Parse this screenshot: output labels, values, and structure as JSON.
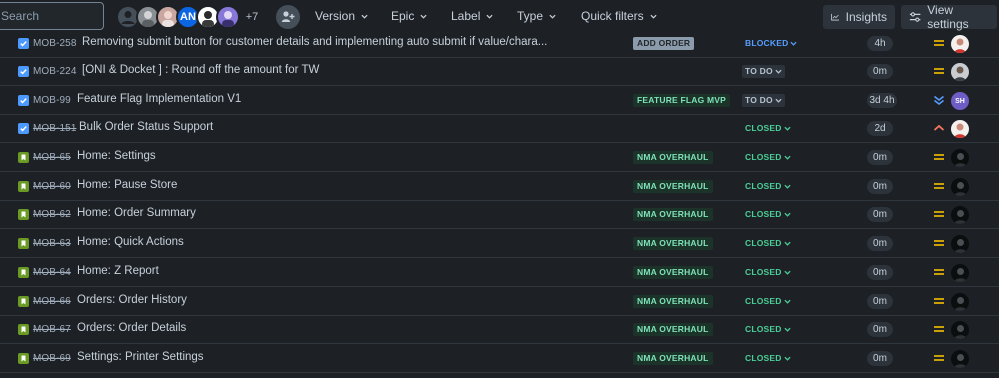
{
  "toolbar": {
    "search_placeholder": "Search",
    "avatar_initials": "AN",
    "more_count": "+7",
    "filters": [
      "Version",
      "Epic",
      "Label",
      "Type",
      "Quick filters"
    ],
    "insights_label": "Insights",
    "view_settings_label": "View settings"
  },
  "rows": [
    {
      "type": "task",
      "key": "MOB-258",
      "done": false,
      "summary": "Removing submit button for customer details and implementing auto submit if value/chara...",
      "label": "ADD ORDER",
      "status": "BLOCKED",
      "estimate": "4h",
      "priority": "medium"
    },
    {
      "type": "task",
      "key": "MOB-224",
      "done": false,
      "summary": "[ONI & Docket ] : Round off the amount for TW",
      "label": "",
      "status": "TO DO",
      "estimate": "0m",
      "priority": "medium"
    },
    {
      "type": "task",
      "key": "MOB-99",
      "done": false,
      "summary": "Feature Flag Implementation V1",
      "label": "FEATURE FLAG MVP",
      "status": "TO DO",
      "estimate": "3d 4h",
      "priority": "lowest",
      "assignee_initials": "SH"
    },
    {
      "type": "task",
      "key": "MOB-151",
      "done": true,
      "summary": "Bulk Order Status Support",
      "label": "",
      "status": "CLOSED",
      "estimate": "2d",
      "priority": "high"
    },
    {
      "type": "story",
      "key": "MOB-65",
      "done": true,
      "summary": "Home: Settings",
      "label": "NMA OVERHAUL",
      "status": "CLOSED",
      "estimate": "0m",
      "priority": "medium"
    },
    {
      "type": "story",
      "key": "MOB-60",
      "done": true,
      "summary": "Home: Pause Store",
      "label": "NMA OVERHAUL",
      "status": "CLOSED",
      "estimate": "0m",
      "priority": "medium"
    },
    {
      "type": "story",
      "key": "MOB-62",
      "done": true,
      "summary": "Home: Order Summary",
      "label": "NMA OVERHAUL",
      "status": "CLOSED",
      "estimate": "0m",
      "priority": "medium"
    },
    {
      "type": "story",
      "key": "MOB-63",
      "done": true,
      "summary": "Home: Quick Actions",
      "label": "NMA OVERHAUL",
      "status": "CLOSED",
      "estimate": "0m",
      "priority": "medium"
    },
    {
      "type": "story",
      "key": "MOB-64",
      "done": true,
      "summary": "Home: Z Report",
      "label": "NMA OVERHAUL",
      "status": "CLOSED",
      "estimate": "0m",
      "priority": "medium"
    },
    {
      "type": "story",
      "key": "MOB-66",
      "done": true,
      "summary": "Orders: Order History",
      "label": "NMA OVERHAUL",
      "status": "CLOSED",
      "estimate": "0m",
      "priority": "medium"
    },
    {
      "type": "story",
      "key": "MOB-67",
      "done": true,
      "summary": "Orders: Order Details",
      "label": "NMA OVERHAUL",
      "status": "CLOSED",
      "estimate": "0m",
      "priority": "medium"
    },
    {
      "type": "story",
      "key": "MOB-69",
      "done": true,
      "summary": "Settings: Printer Settings",
      "label": "NMA OVERHAUL",
      "status": "CLOSED",
      "estimate": "0m",
      "priority": "medium"
    }
  ],
  "colors": {
    "background": "#1d2125",
    "lozenge_green_text": "#7ee2b8",
    "status_closed": "#4bce97",
    "status_blocked": "#579dff",
    "priority_medium": "#e2b203",
    "priority_high": "#f87462",
    "priority_lowest": "#579dff"
  }
}
